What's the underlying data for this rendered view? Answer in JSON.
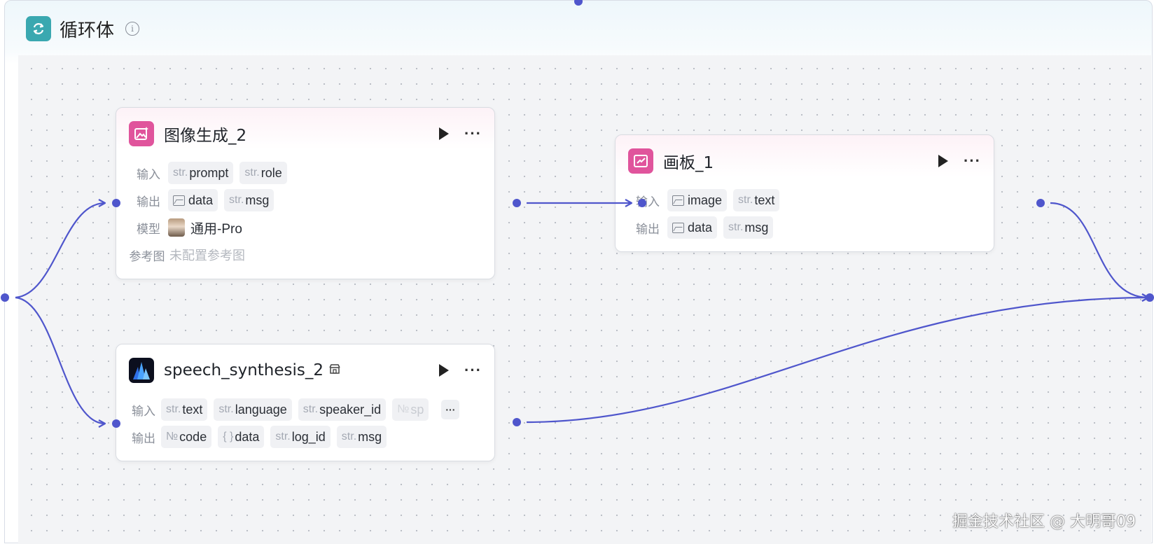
{
  "container": {
    "title": "循环体",
    "icon": "loop-icon",
    "accent": "#3aa8b0"
  },
  "nodes": {
    "image_gen": {
      "title": "图像生成_2",
      "icon": "image-generate-icon",
      "labels": {
        "input": "输入",
        "output": "输出",
        "model": "模型",
        "ref": "参考图"
      },
      "inputs": [
        {
          "type": "str.",
          "name": "prompt"
        },
        {
          "type": "str.",
          "name": "role"
        }
      ],
      "outputs": [
        {
          "type": "image",
          "name": "data"
        },
        {
          "type": "str.",
          "name": "msg"
        }
      ],
      "model": "通用-Pro",
      "ref_value": "未配置参考图"
    },
    "canvas_board": {
      "title": "画板_1",
      "icon": "canvas-board-icon",
      "labels": {
        "input": "输入",
        "output": "输出"
      },
      "inputs": [
        {
          "type": "image",
          "name": "image"
        },
        {
          "type": "str.",
          "name": "text"
        }
      ],
      "outputs": [
        {
          "type": "image",
          "name": "data"
        },
        {
          "type": "str.",
          "name": "msg"
        }
      ]
    },
    "speech": {
      "title": "speech_synthesis_2",
      "icon": "speech-plugin-icon",
      "labels": {
        "input": "输入",
        "output": "输出"
      },
      "inputs": [
        {
          "type": "str.",
          "name": "text"
        },
        {
          "type": "str.",
          "name": "language"
        },
        {
          "type": "str.",
          "name": "speaker_id"
        },
        {
          "type": "№",
          "name": "sp"
        }
      ],
      "more_label": "···",
      "outputs": [
        {
          "type": "№",
          "name": "code"
        },
        {
          "type": "{ }",
          "name": "data"
        },
        {
          "type": "str.",
          "name": "log_id"
        },
        {
          "type": "str.",
          "name": "msg"
        }
      ]
    }
  },
  "actions": {
    "more": "···"
  },
  "watermark": "掘金技术社区 @ 大明哥09",
  "colors": {
    "edge": "#4f56cc",
    "node_accent_pink": "#e0549c"
  }
}
